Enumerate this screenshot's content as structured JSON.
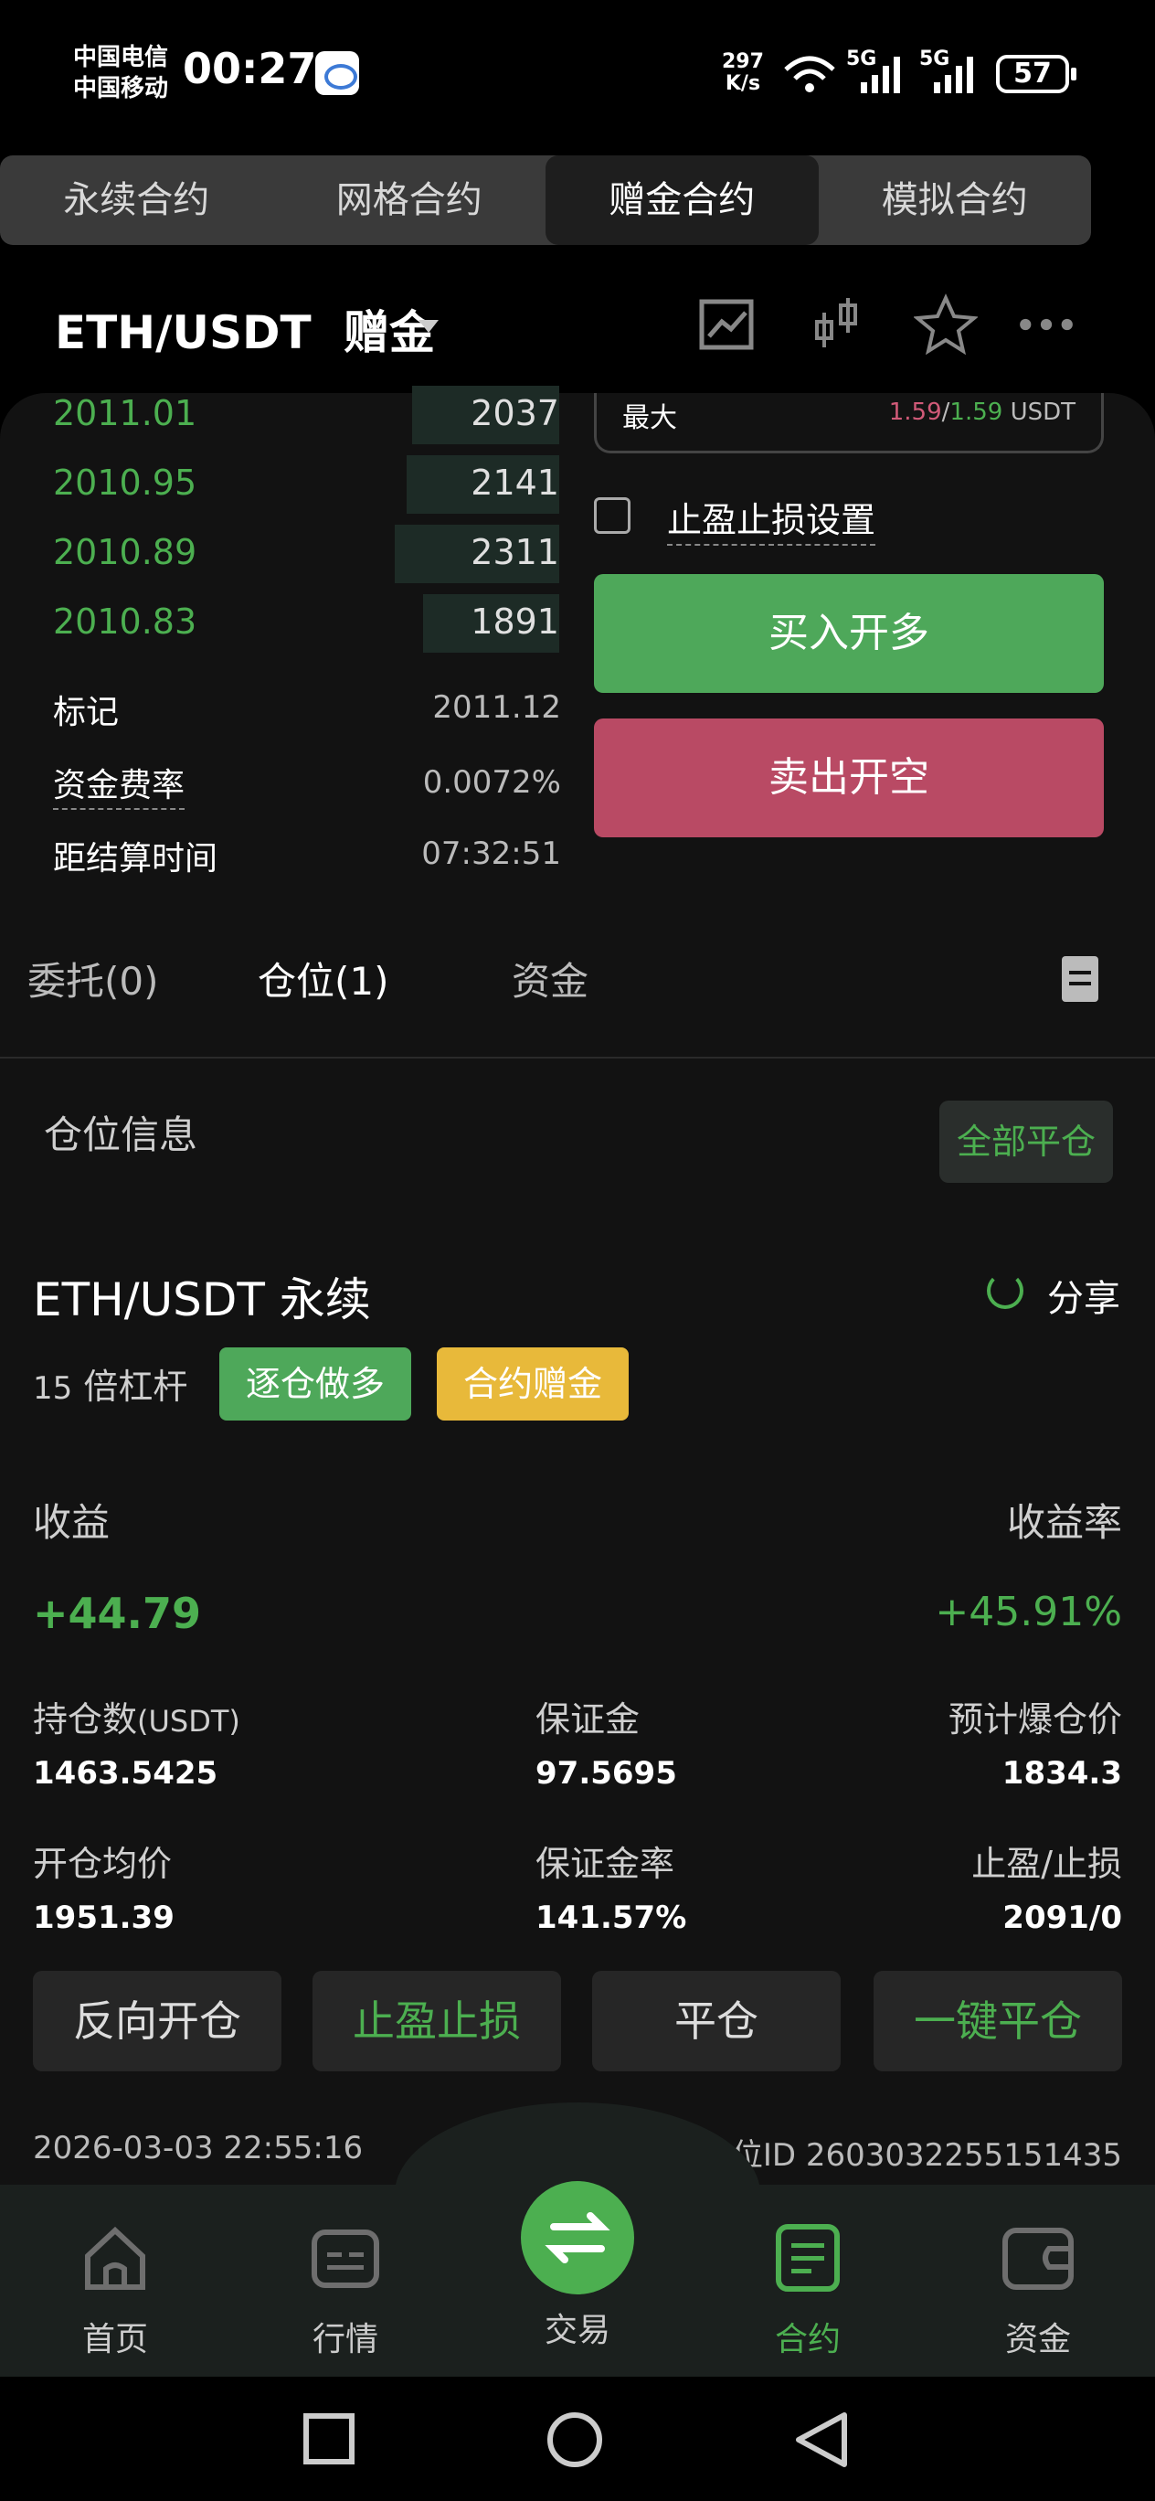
{
  "status_bar": {
    "carrier1": "中国电信",
    "carrier2": "中国移动",
    "time": "00:27",
    "net_speed_value": "297",
    "net_speed_unit": "K/s",
    "signal1": "5G",
    "signal2": "5G",
    "battery": "57"
  },
  "contract_tabs": [
    {
      "label": "永续合约"
    },
    {
      "label": "网格合约"
    },
    {
      "label": "赠金合约"
    },
    {
      "label": "模拟合约"
    }
  ],
  "header": {
    "pair": "ETH/USDT",
    "mode": "赠金"
  },
  "order_book": [
    {
      "price": "2011.01",
      "qty": "2037",
      "depth": 0.26
    },
    {
      "price": "2010.95",
      "qty": "2141",
      "depth": 0.27
    },
    {
      "price": "2010.89",
      "qty": "2311",
      "depth": 0.29
    },
    {
      "price": "2010.83",
      "qty": "1891",
      "depth": 0.24
    }
  ],
  "market_info": {
    "mark_label": "标记",
    "mark_value": "2011.12",
    "funding_label": "资金费率",
    "funding_value": "0.0072%",
    "settle_label": "距结算时间",
    "settle_value": "07:32:51"
  },
  "order_form": {
    "max_label": "最大",
    "max_buy": "1.59",
    "max_sep": "/",
    "max_sell": "1.59",
    "max_unit": "USDT",
    "tpsl_label": "止盈止损设置",
    "buy_label": "买入开多",
    "sell_label": "卖出开空"
  },
  "order_tabs": {
    "orders": "委托(0)",
    "positions": "仓位(1)",
    "funds": "资金"
  },
  "positions_section": {
    "title": "仓位信息",
    "close_all": "全部平仓"
  },
  "position": {
    "symbol": "ETH/USDT 永续",
    "share": "分享",
    "leverage_num": "15",
    "leverage_text": "倍杠杆",
    "badge_side": "逐仓做多",
    "badge_type": "合约赠金",
    "pnl_label": "收益",
    "pnl_value": "+44.79",
    "roe_label": "收益率",
    "roe_value": "+45.91%",
    "size_label": "持仓数",
    "size_unit": "(USDT)",
    "size_value": "1463.5425",
    "margin_label": "保证金",
    "margin_value": "97.5695",
    "liq_label": "预计爆仓价",
    "liq_value": "1834.3",
    "entry_label": "开仓均价",
    "entry_value": "1951.39",
    "margin_ratio_label": "保证金率",
    "margin_ratio_value": "141.57%",
    "tpsl_label": "止盈/止损",
    "tpsl_value": "2091/0",
    "btn_reverse": "反向开仓",
    "btn_tpsl": "止盈止损",
    "btn_close": "平仓",
    "btn_close_all": "一键平仓",
    "time": "2026-03-03 22:55:16",
    "id_label": "仓位ID",
    "id_value": "2603032255151435"
  },
  "bottom_nav": [
    {
      "label": "首页",
      "icon": "home-icon"
    },
    {
      "label": "行情",
      "icon": "market-icon"
    },
    {
      "label": "交易",
      "icon": "swap-icon"
    },
    {
      "label": "合约",
      "icon": "contract-icon"
    },
    {
      "label": "资金",
      "icon": "wallet-icon"
    }
  ],
  "colors": {
    "green": "#4caf50",
    "red": "#b94a64",
    "yellow": "#e8b93a"
  }
}
